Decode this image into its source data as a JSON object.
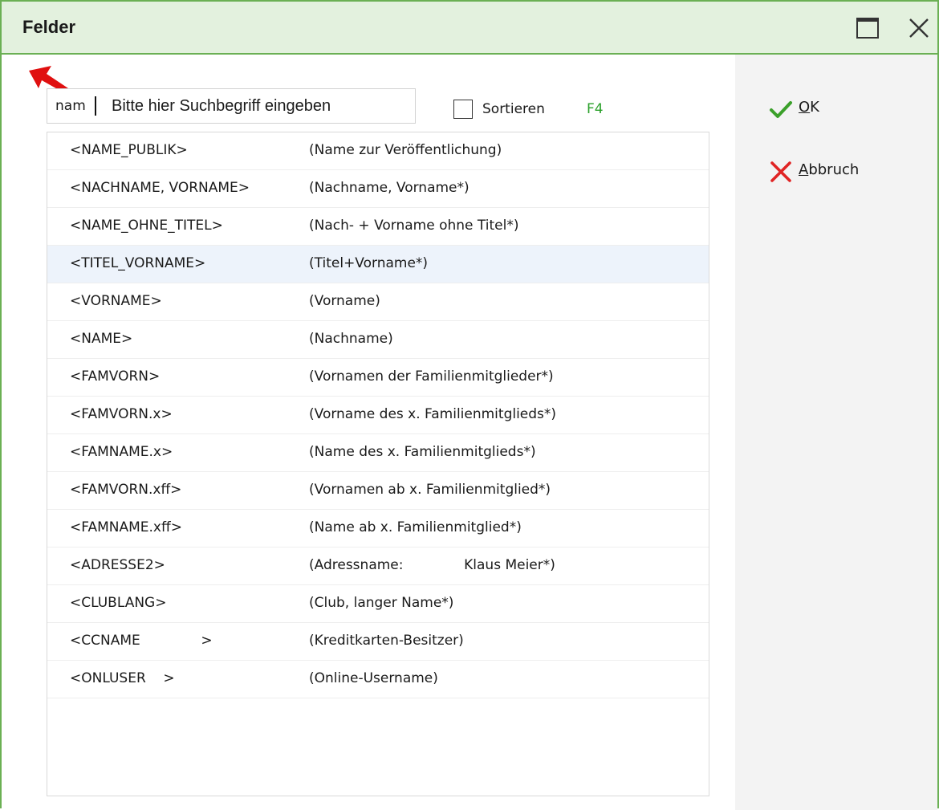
{
  "window": {
    "title": "Felder"
  },
  "titlebar_buttons": {
    "maximize_icon": "maximize-icon",
    "close_icon": "close-icon"
  },
  "search": {
    "value": "nam",
    "placeholder": "Bitte hier Suchbegriff eingeben"
  },
  "sort": {
    "label": "Sortieren",
    "checked": false,
    "shortcut": "F4"
  },
  "fields": [
    {
      "field": "<NAME_PUBLIK>",
      "description": "(Name zur Veröffentlichung)"
    },
    {
      "field": "<NACHNAME, VORNAME>",
      "description": "(Nachname, Vorname*)"
    },
    {
      "field": "<NAME_OHNE_TITEL>",
      "description": "(Nach- + Vorname ohne Titel*)"
    },
    {
      "field": "<TITEL_VORNAME>",
      "description": "(Titel+Vorname*)",
      "selected": true
    },
    {
      "field": "<VORNAME>",
      "description": "(Vorname)"
    },
    {
      "field": "<NAME>",
      "description": "(Nachname)"
    },
    {
      "field": "<FAMVORN>",
      "description": "(Vornamen der Familienmitglieder*)"
    },
    {
      "field": "<FAMVORN.x>",
      "description": "(Vorname des x. Familienmitglieds*)"
    },
    {
      "field": "<FAMNAME.x>",
      "description": "(Name des x. Familienmitglieds*)"
    },
    {
      "field": "<FAMVORN.xff>",
      "description": "(Vornamen ab x. Familienmitglied*)"
    },
    {
      "field": "<FAMNAME.xff>",
      "description": "(Name ab x. Familienmitglied*)"
    },
    {
      "field": "<ADRESSE2>",
      "description": "(Adressname:              Klaus Meier*)"
    },
    {
      "field": "<CLUBLANG>",
      "description": "(Club, langer Name*)"
    },
    {
      "field": "<CCNAME              >",
      "description": "(Kreditkarten-Besitzer)"
    },
    {
      "field": "<ONLUSER    >",
      "description": "(Online-Username)"
    }
  ],
  "actions": {
    "ok": {
      "mnemonic": "O",
      "rest": "K",
      "icon": "checkmark-icon",
      "color": "#3aa02a"
    },
    "cancel": {
      "mnemonic": "A",
      "rest": "bbruch",
      "icon": "cross-icon",
      "color": "#e02424"
    }
  },
  "colors": {
    "titlebar_bg": "#e3f1de",
    "border": "#6bb054",
    "selected_row": "#edf3fb",
    "shortcut_green": "#2aa02a",
    "annotation_arrow": "#e01010"
  }
}
